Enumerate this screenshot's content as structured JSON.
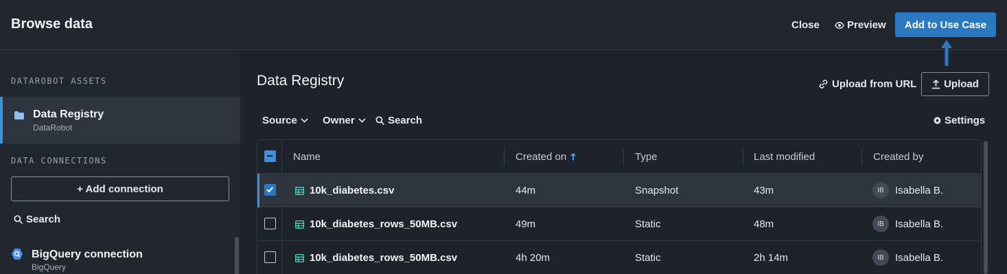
{
  "header": {
    "title": "Browse data",
    "close_label": "Close",
    "preview_label": "Preview",
    "add_label": "Add to Use Case"
  },
  "sidebar": {
    "assets_heading": "DATAROBOT ASSETS",
    "active_item": {
      "title": "Data Registry",
      "subtitle": "DataRobot"
    },
    "connections_heading": "DATA CONNECTIONS",
    "add_connection_label": "+ Add connection",
    "search_label": "Search",
    "connection": {
      "title": "BigQuery connection",
      "subtitle": "BigQuery"
    }
  },
  "main": {
    "title": "Data Registry",
    "upload_url_label": "Upload from URL",
    "upload_label": "Upload",
    "filters": {
      "source": "Source",
      "owner": "Owner",
      "search": "Search"
    },
    "settings_label": "Settings"
  },
  "table": {
    "columns": [
      "Name",
      "Created on",
      "Type",
      "Last modified",
      "Created by"
    ],
    "rows": [
      {
        "name": "10k_diabetes.csv",
        "created": "44m",
        "type": "Snapshot",
        "modified": "43m",
        "initials": "IB",
        "creator": "Isabella B.",
        "selected": true
      },
      {
        "name": "10k_diabetes_rows_50MB.csv",
        "created": "49m",
        "type": "Static",
        "modified": "48m",
        "initials": "IB",
        "creator": "Isabella B.",
        "selected": false
      },
      {
        "name": "10k_diabetes_rows_50MB.csv",
        "created": "4h 20m",
        "type": "Static",
        "modified": "2h 14m",
        "initials": "IB",
        "creator": "Isabella B.",
        "selected": false
      }
    ]
  },
  "colors": {
    "accent": "#2a78c0",
    "selection": "#3b91e0"
  },
  "icons": [
    "eye-icon",
    "link-icon",
    "upload-icon",
    "chevron-down-icon",
    "search-icon",
    "gear-icon",
    "folder-icon",
    "bigquery-icon",
    "table-file-icon",
    "sort-asc-icon",
    "arrow-up-icon"
  ]
}
